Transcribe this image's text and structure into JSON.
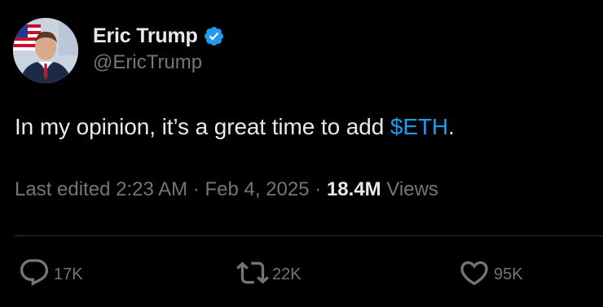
{
  "author": {
    "display_name": "Eric Trump",
    "handle": "@EricTrump",
    "verified": true
  },
  "tweet": {
    "text_before": "In my opinion, it’s a great time to add ",
    "cashtag": "$ETH",
    "text_after": "."
  },
  "meta": {
    "edited_prefix": "Last edited",
    "time": "2:23 AM",
    "separator": "·",
    "date": "Feb 4, 2025",
    "views_count": "18.4M",
    "views_label": "Views"
  },
  "actions": {
    "replies": "17K",
    "reposts": "22K",
    "likes": "95K"
  },
  "colors": {
    "background": "#000000",
    "text": "#e7e9ea",
    "secondary": "#71767b",
    "accent": "#1d9bf0",
    "divider": "#2f3336"
  },
  "icons": {
    "verified": "verified-badge-icon",
    "reply": "reply-icon",
    "repost": "repost-icon",
    "like": "heart-icon"
  }
}
